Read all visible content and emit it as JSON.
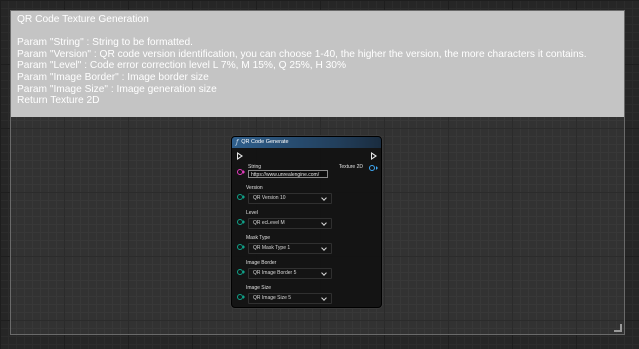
{
  "comment": {
    "lines": [
      "QR Code Texture Generation",
      "",
      "Param \"String\" : String to be formatted.",
      "Param \"Version\" : QR code version identification, you can choose 1-40, the higher the version, the more characters it contains.",
      "Param \"Level\" : Code error correction level L 7%, M 15%, Q 25%, H 30%",
      "Param \"Image Border\" : Image border size",
      "Param \"Image Size\" : Image generation size",
      "Return Texture 2D"
    ]
  },
  "node": {
    "title": "QR Code Generate",
    "output_label": "Texture 2D",
    "inputs": {
      "string": {
        "label": "String",
        "value": "https://www.unrealengine.com/"
      },
      "version": {
        "label": "Version",
        "value": "QR Version 10"
      },
      "level": {
        "label": "Level",
        "value": "QR ecLevel M"
      },
      "mask": {
        "label": "Mask Type",
        "value": "QR Mask Type 1"
      },
      "border": {
        "label": "Image Border",
        "value": "QR Image Border 5"
      },
      "size": {
        "label": "Image Size",
        "value": "QR Image Size 5"
      }
    }
  },
  "colors": {
    "string_pin": "#e63dbf",
    "enum_pin": "#0fa38a",
    "texture_pin": "#3fa9f5",
    "title_bar": "#2f5f8c",
    "comment_header": "#c4c4c4"
  },
  "icons": {
    "function": "function-icon",
    "exec": "exec-pin-icon"
  }
}
